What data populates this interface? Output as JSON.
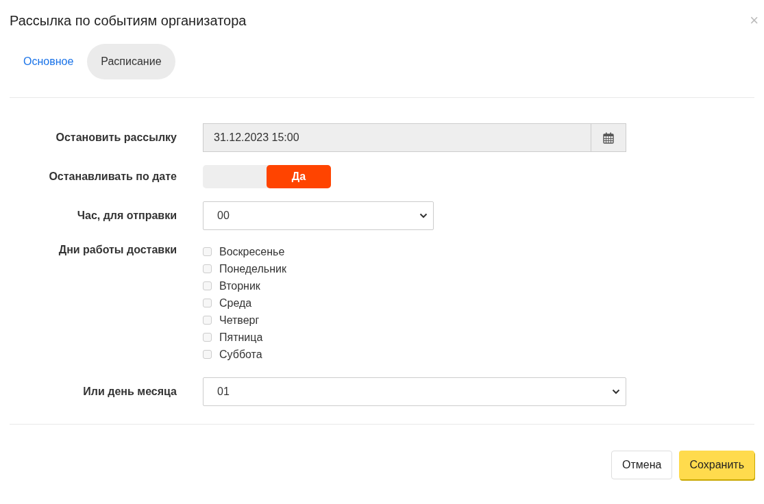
{
  "dialog": {
    "title": "Рассылка по событиям организатора",
    "close": "×"
  },
  "tabs": [
    {
      "label": "Основное",
      "selected": false
    },
    {
      "label": "Расписание",
      "selected": true
    }
  ],
  "form": {
    "stop_date": {
      "label": "Остановить рассылку",
      "value": "31.12.2023 15:00",
      "disabled": true
    },
    "stop_by_date": {
      "label": "Останавливать по дате",
      "option": "Да",
      "on": true
    },
    "hour": {
      "label": "Час, для отправки",
      "value": "00"
    },
    "days": {
      "label": "Дни работы доставки",
      "items": [
        {
          "label": "Воскресенье",
          "checked": false
        },
        {
          "label": "Понедельник",
          "checked": false
        },
        {
          "label": "Вторник",
          "checked": false
        },
        {
          "label": "Среда",
          "checked": false
        },
        {
          "label": "Четверг",
          "checked": false
        },
        {
          "label": "Пятница",
          "checked": false
        },
        {
          "label": "Суббота",
          "checked": false
        }
      ]
    },
    "month_day": {
      "label": "Или день месяца",
      "value": "01"
    }
  },
  "buttons": [
    {
      "label": "Отмена",
      "kind": "secondary"
    },
    {
      "label": "Сохранить",
      "kind": "primary"
    }
  ]
}
